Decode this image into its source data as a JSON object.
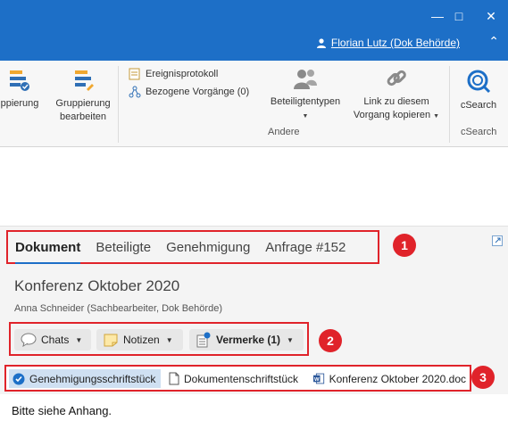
{
  "window": {
    "user_name": "Florian Lutz (Dok Behörde)"
  },
  "ribbon": {
    "group_button_1": "ppierung",
    "group_button_2_line1": "Gruppierung",
    "group_button_2_line2": "bearbeiten",
    "ereignisprotokoll": "Ereignisprotokoll",
    "bezogene_vorgaenge": "Bezogene Vorgänge (0)",
    "beteiligtentypen": "Beteiligtentypen",
    "link_line1": "Link zu diesem",
    "link_line2": "Vorgang kopieren",
    "andere_label": "Andere",
    "csearch": "cSearch",
    "csearch_group": "cSearch"
  },
  "tabs": [
    {
      "label": "Dokument",
      "active": true
    },
    {
      "label": "Beteiligte",
      "active": false
    },
    {
      "label": "Genehmigung",
      "active": false
    },
    {
      "label": "Anfrage #152",
      "active": false
    }
  ],
  "document": {
    "title": "Konferenz Oktober 2020",
    "subtitle": "Anna Schneider (Sachbearbeiter, Dok Behörde)"
  },
  "toolbar": {
    "chats": "Chats",
    "notizen": "Notizen",
    "vermerke": "Vermerke (1)"
  },
  "attachments": [
    {
      "label": "Genehmigungsschriftstück",
      "selected": true
    },
    {
      "label": "Dokumentenschriftstück",
      "selected": false
    },
    {
      "label": "Konferenz Oktober 2020.doc",
      "selected": false
    }
  ],
  "body": {
    "text": "Bitte siehe Anhang."
  },
  "badges": [
    "1",
    "2",
    "3"
  ],
  "colors": {
    "accent": "#1d6fc7",
    "highlight": "#e0232a",
    "selected": "#cfe0f2"
  }
}
